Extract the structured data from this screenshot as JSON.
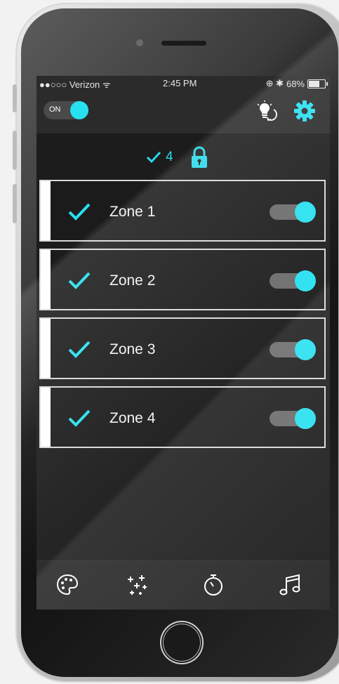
{
  "status_bar": {
    "carrier": "●●○○○ Verizon ᯤ",
    "time": "2:45 PM",
    "right_icons": "⊕ ✱",
    "battery_percent_text": "68%",
    "battery_level": 0.68
  },
  "header": {
    "master_toggle_label": "ON",
    "master_toggle_state": "on",
    "accent_color": "#27e0f0"
  },
  "summary": {
    "active_count": "4"
  },
  "zones": [
    {
      "label": "Zone 1",
      "checked": true,
      "enabled": true
    },
    {
      "label": "Zone 2",
      "checked": true,
      "enabled": true
    },
    {
      "label": "Zone 3",
      "checked": true,
      "enabled": true
    },
    {
      "label": "Zone 4",
      "checked": true,
      "enabled": true
    }
  ],
  "tabbar": {
    "tabs": [
      {
        "icon": "palette-icon"
      },
      {
        "icon": "sparkles-icon"
      },
      {
        "icon": "timer-icon"
      },
      {
        "icon": "music-note-icon"
      }
    ]
  }
}
